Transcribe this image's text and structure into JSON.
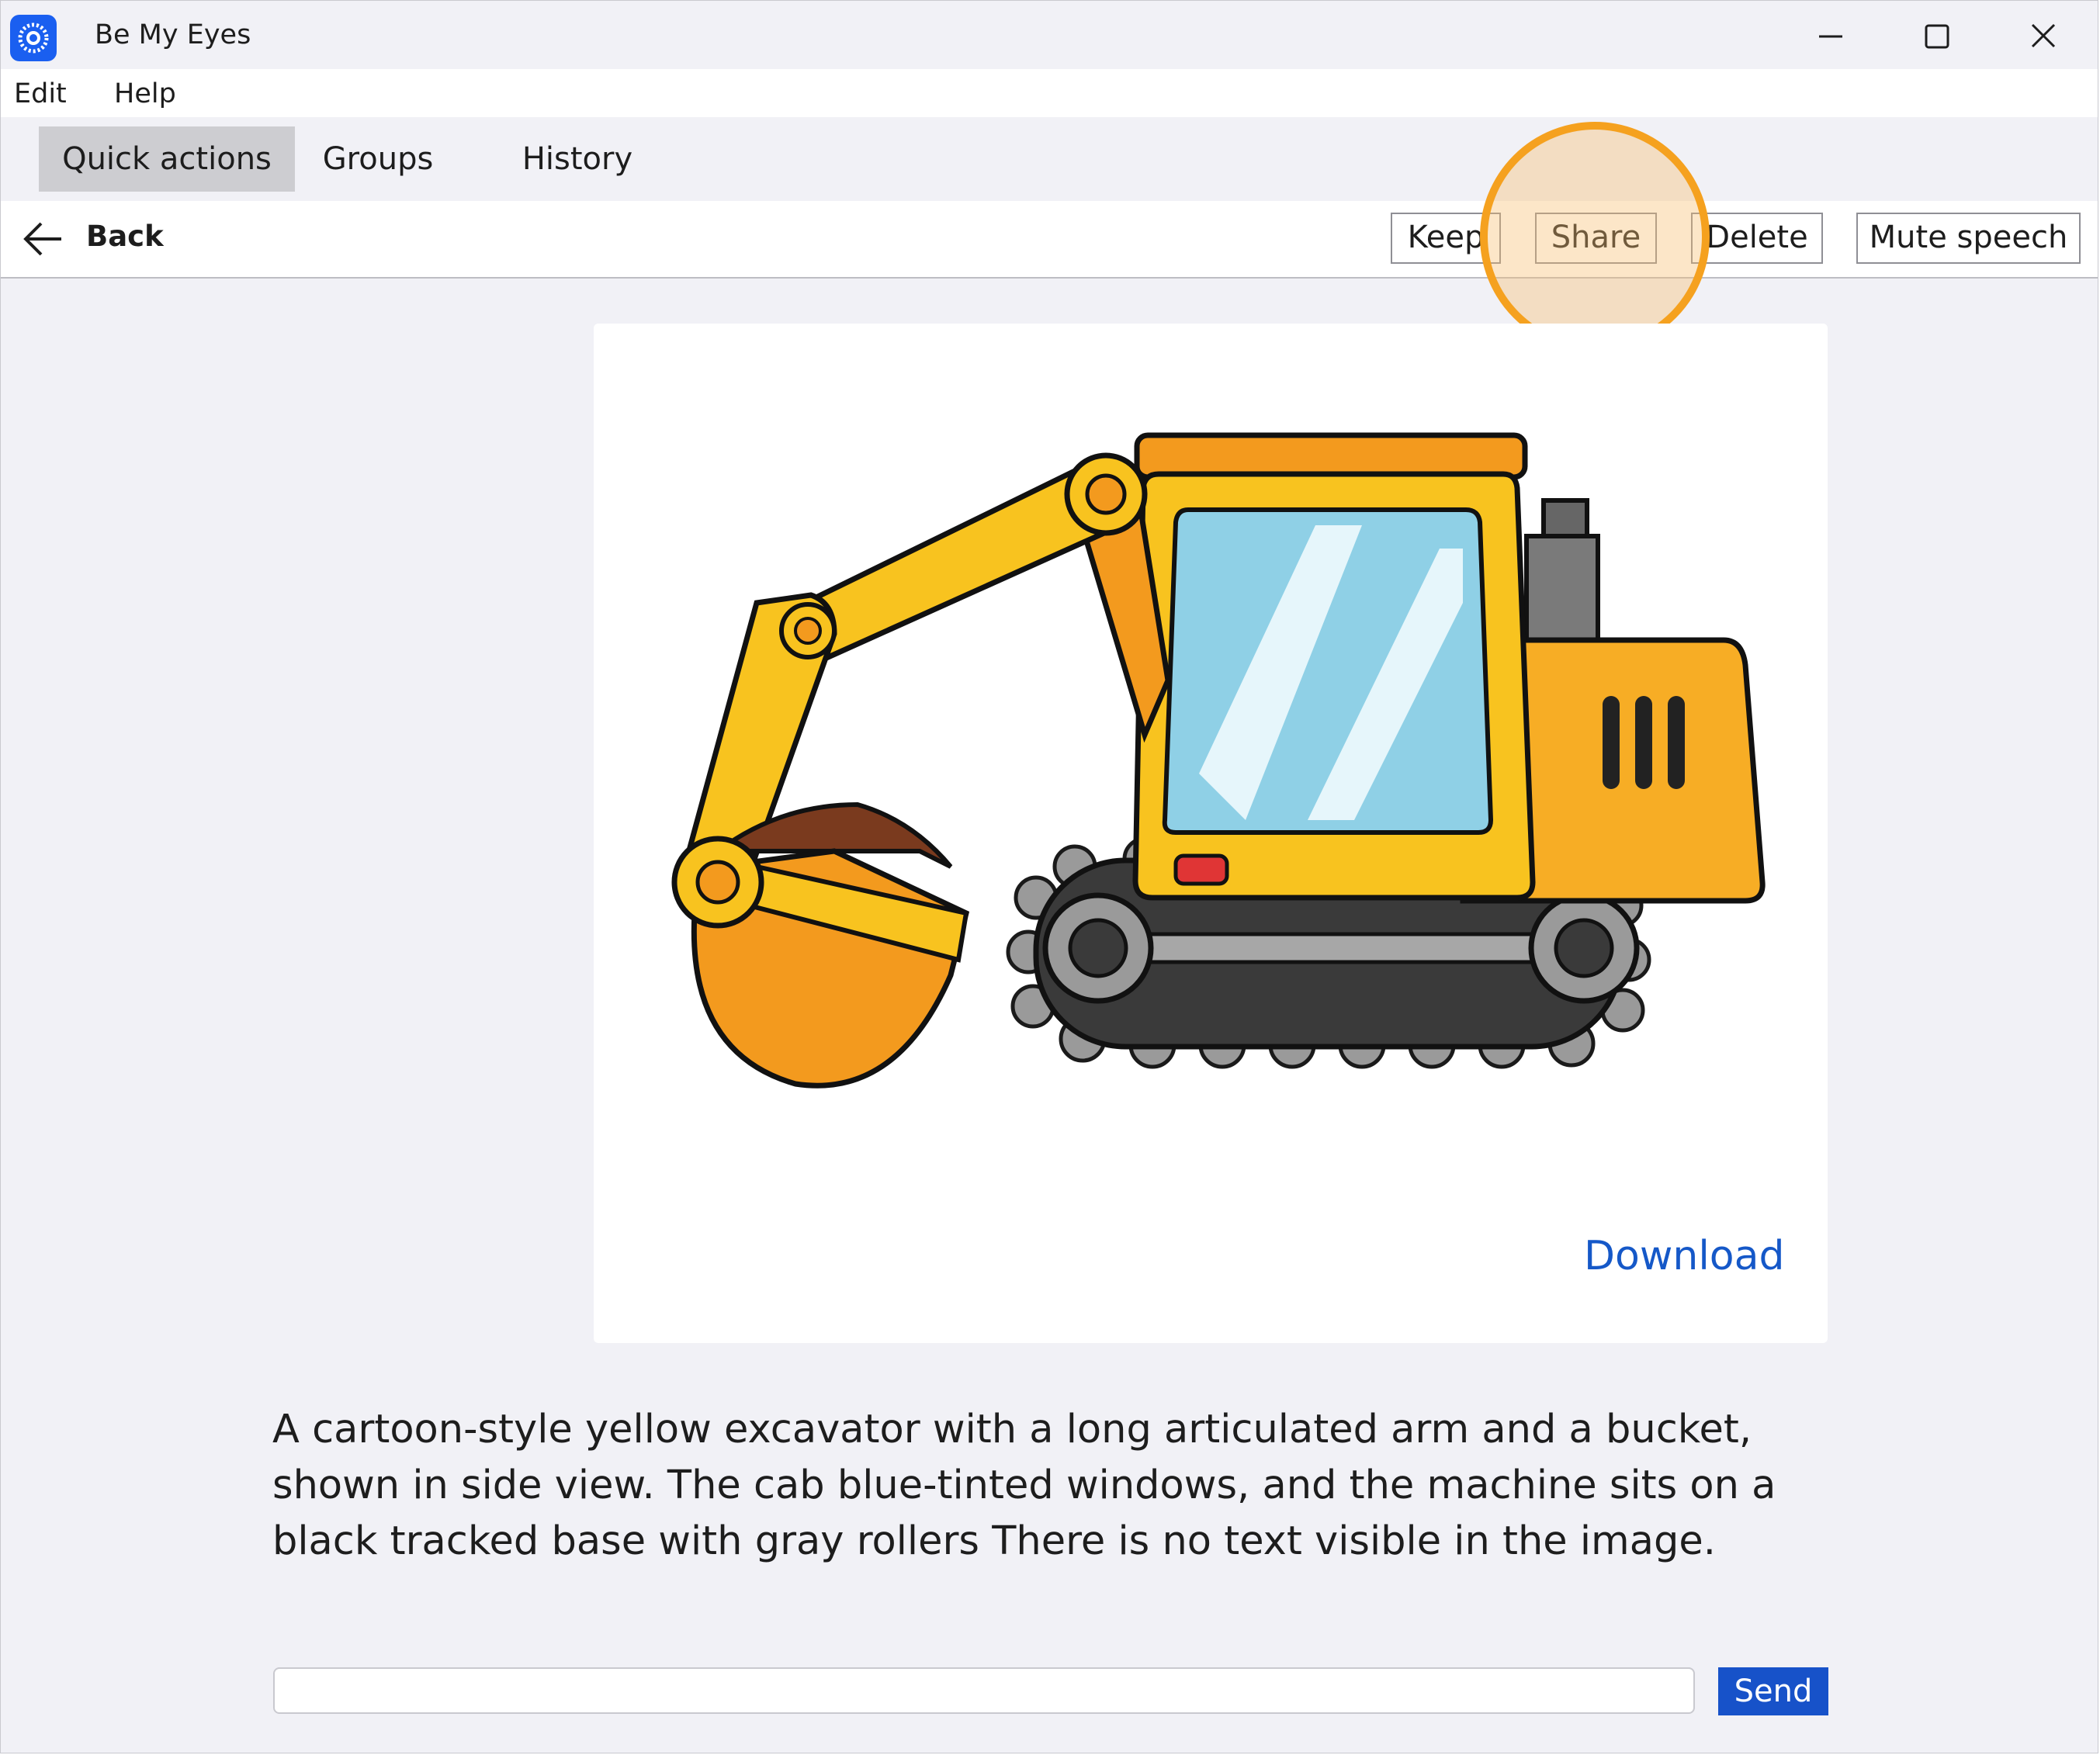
{
  "window": {
    "title": "Be My Eyes"
  },
  "menu": {
    "items": [
      "Edit",
      "Help"
    ]
  },
  "tabs": [
    {
      "label": "Quick actions",
      "active": true
    },
    {
      "label": "Groups",
      "active": false
    },
    {
      "label": "History",
      "active": false
    }
  ],
  "toolbar": {
    "back_label": "Back",
    "keep_label": "Keep",
    "share_label": "Share",
    "delete_label": "Delete",
    "mute_label": "Mute speech"
  },
  "image": {
    "download_label": "Download"
  },
  "description": "A cartoon-style yellow excavator with a long articulated arm and a bucket, shown in side view. The cab blue-tinted windows, and the machine sits on a black tracked base with gray rollers There is no text visible in the image.",
  "chat": {
    "input_value": "",
    "send_label": "Send"
  },
  "colors": {
    "accent": "#1752c9",
    "highlight": "#f5a11f",
    "link": "#1558c8"
  }
}
